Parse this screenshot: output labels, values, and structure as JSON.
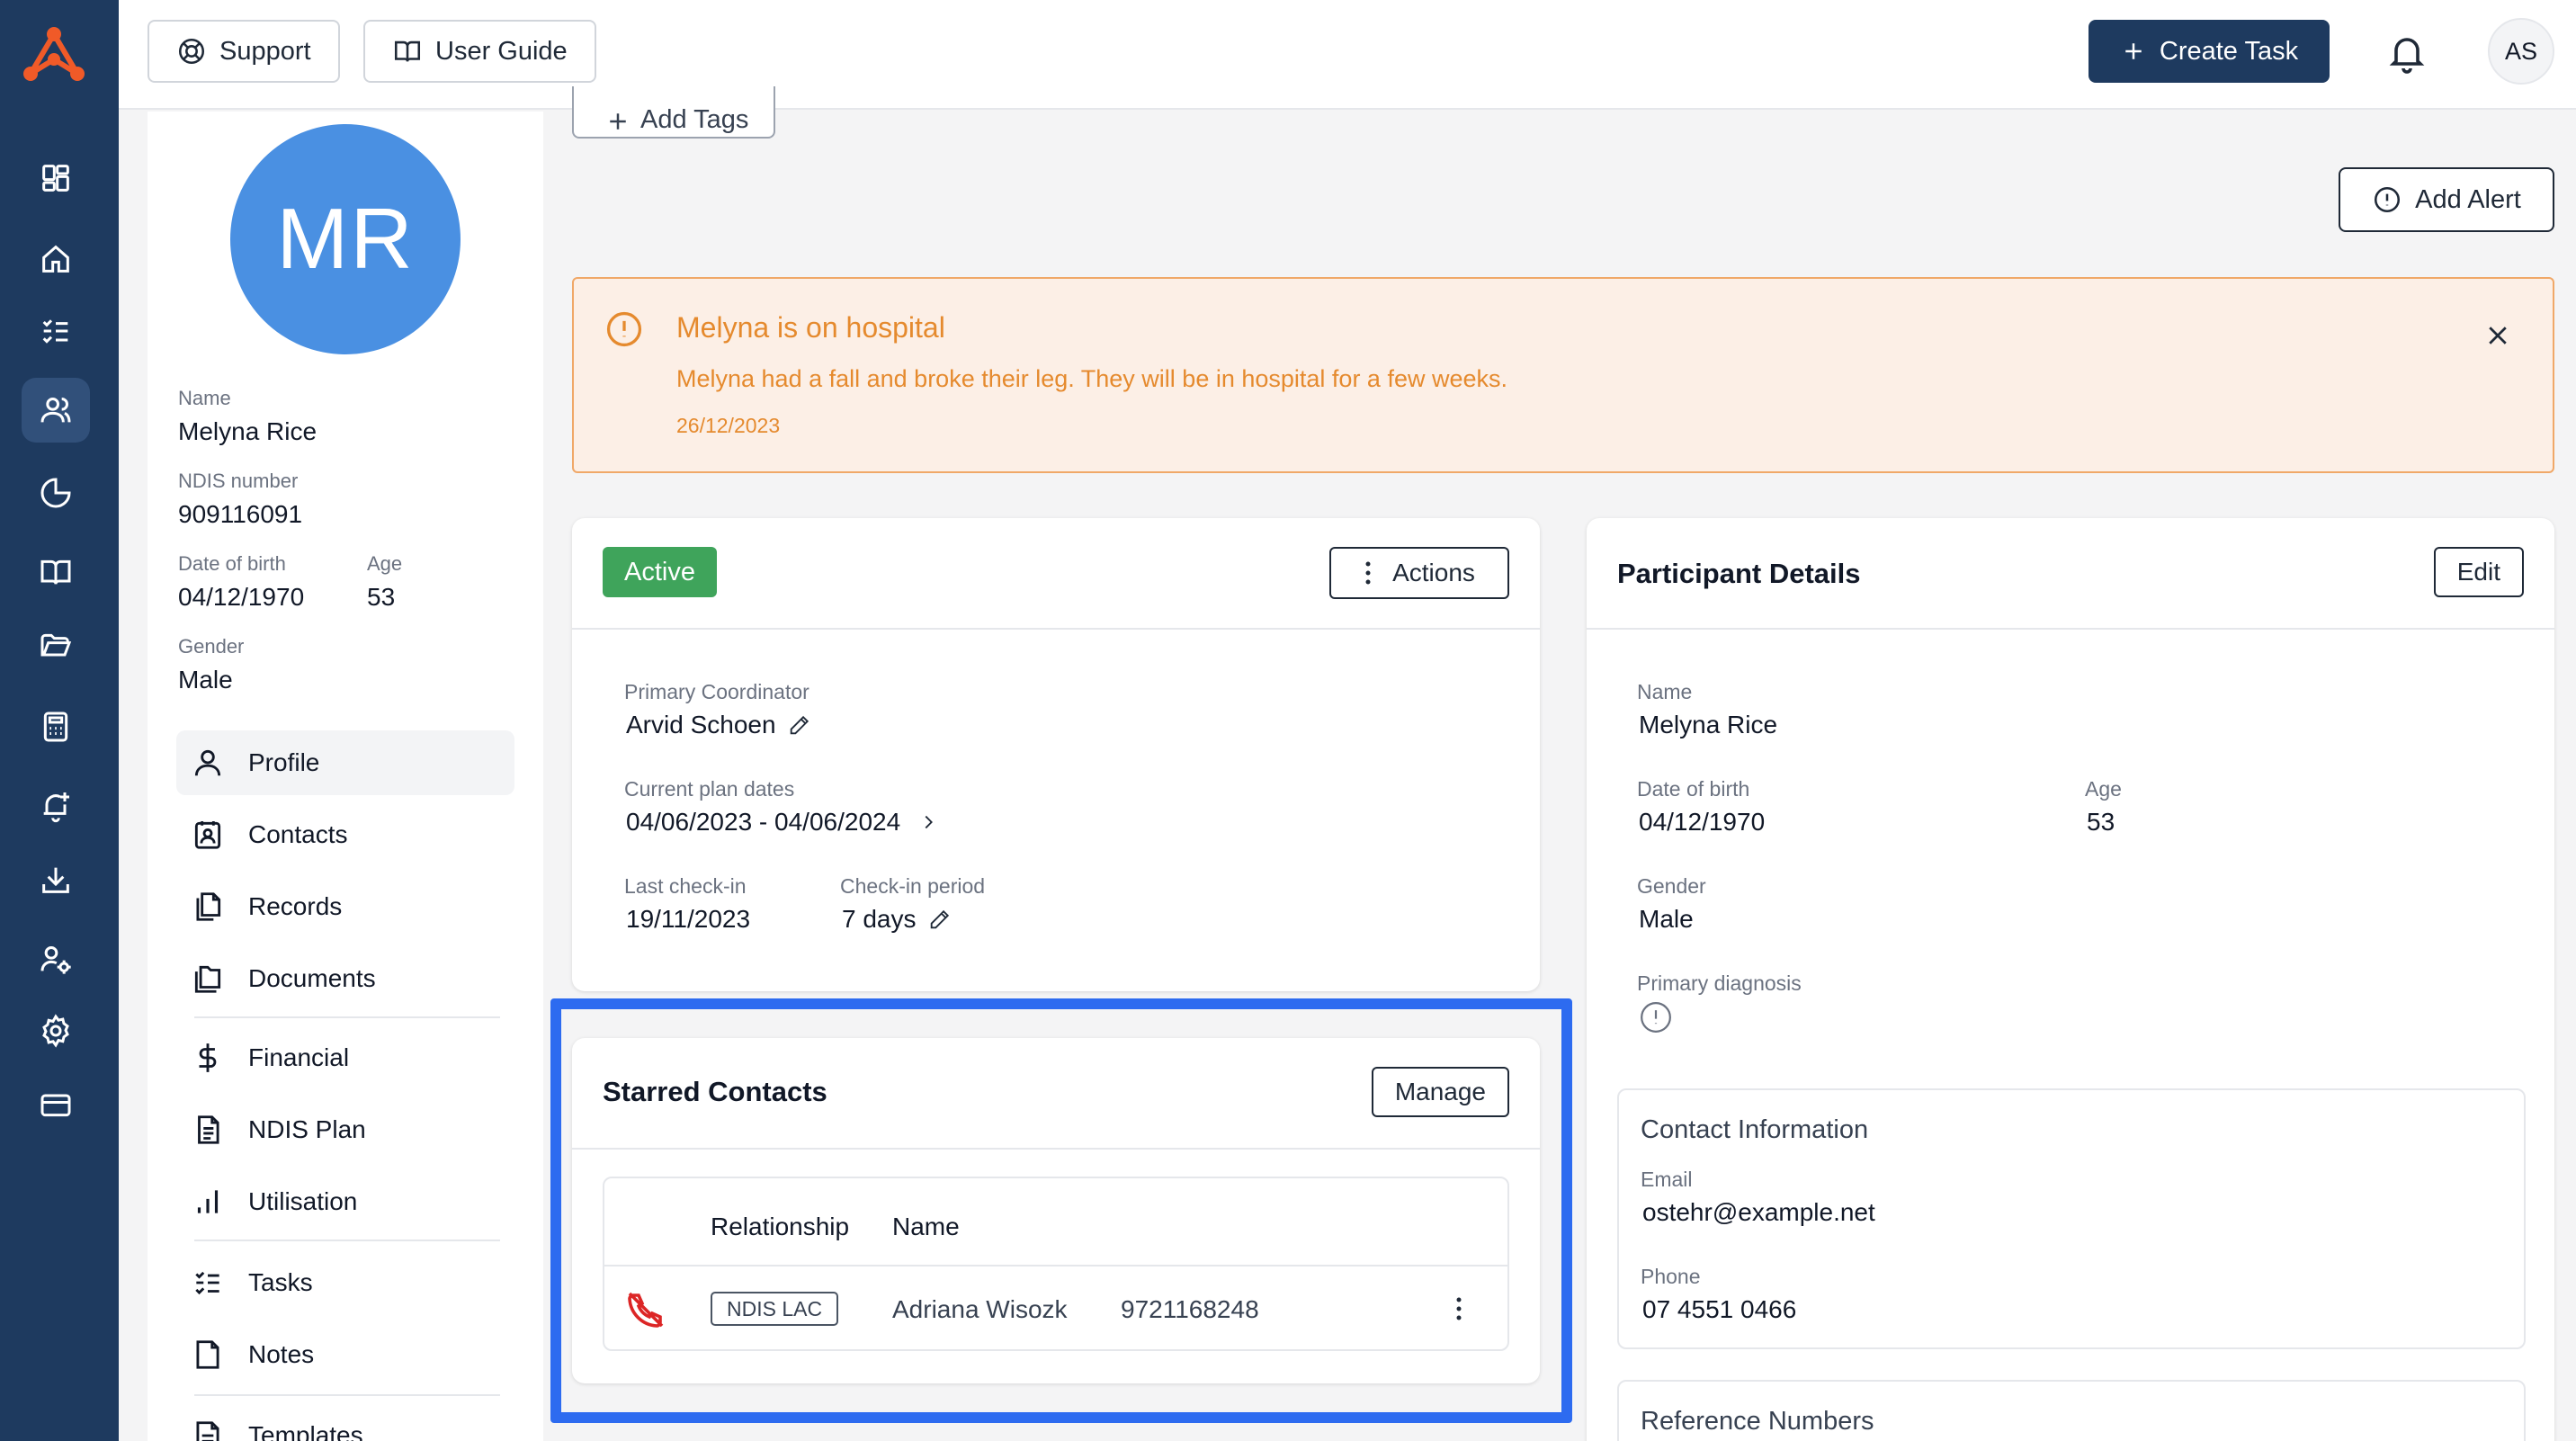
{
  "header": {
    "support_label": "Support",
    "user_guide_label": "User Guide",
    "create_task_label": "Create Task",
    "user_initials": "AS"
  },
  "profile": {
    "initials": "MR",
    "name_label": "Name",
    "name": "Melyna Rice",
    "ndis_label": "NDIS number",
    "ndis_number": "909116091",
    "dob_label": "Date of birth",
    "dob": "04/12/1970",
    "age_label": "Age",
    "age": "53",
    "gender_label": "Gender",
    "gender": "Male",
    "nav": [
      {
        "label": "Profile",
        "icon": "user-icon"
      },
      {
        "label": "Contacts",
        "icon": "contacts-icon"
      },
      {
        "label": "Records",
        "icon": "records-icon"
      },
      {
        "label": "Documents",
        "icon": "documents-icon"
      },
      {
        "label": "Financial",
        "icon": "dollar-icon"
      },
      {
        "label": "NDIS Plan",
        "icon": "plan-icon"
      },
      {
        "label": "Utilisation",
        "icon": "bar-chart-icon"
      },
      {
        "label": "Tasks",
        "icon": "tasks-icon"
      },
      {
        "label": "Notes",
        "icon": "note-icon"
      },
      {
        "label": "Templates",
        "icon": "template-icon"
      }
    ]
  },
  "main": {
    "add_tags_label": "Add Tags",
    "add_alert_label": "Add Alert",
    "alert": {
      "title": "Melyna is on hospital",
      "message": "Melyna had a fall and broke their leg. They will be in hospital for a few weeks.",
      "date": "26/12/2023",
      "color": "#e58a2e"
    },
    "status_card": {
      "status": "Active",
      "status_color": "#3fa45b",
      "actions_label": "Actions",
      "coordinator_label": "Primary Coordinator",
      "coordinator": "Arvid Schoen",
      "plan_dates_label": "Current plan dates",
      "plan_dates": "04/06/2023 - 04/06/2024",
      "last_checkin_label": "Last check-in",
      "last_checkin": "19/11/2023",
      "checkin_period_label": "Check-in period",
      "checkin_period": "7 days"
    },
    "starred": {
      "title": "Starred Contacts",
      "manage_label": "Manage",
      "columns": [
        "Relationship",
        "Name"
      ],
      "rows": [
        {
          "relationship": "NDIS LAC",
          "name": "Adriana Wisozk",
          "phone": "9721168248"
        }
      ]
    },
    "participant": {
      "title": "Participant Details",
      "edit_label": "Edit",
      "name_label": "Name",
      "name": "Melyna Rice",
      "dob_label": "Date of birth",
      "dob": "04/12/1970",
      "age_label": "Age",
      "age": "53",
      "gender_label": "Gender",
      "gender": "Male",
      "diagnosis_label": "Primary diagnosis",
      "contact": {
        "title": "Contact Information",
        "email_label": "Email",
        "email": "ostehr@example.net",
        "phone_label": "Phone",
        "phone": "07 4551 0466"
      },
      "reference_title": "Reference Numbers"
    }
  },
  "colors": {
    "rail": "#1e3a5f",
    "accent": "#2d6bf0",
    "avatar": "#4a90e2",
    "logo": "#f05a28"
  }
}
